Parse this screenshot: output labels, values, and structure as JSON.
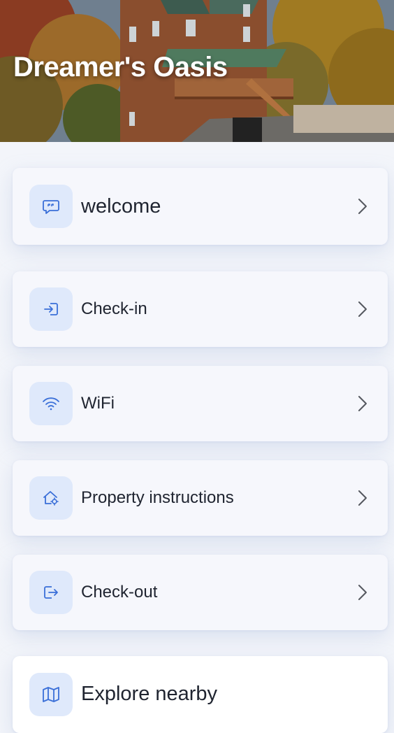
{
  "header": {
    "title": "Dreamer's Oasis"
  },
  "menu": {
    "items": [
      {
        "label": "welcome",
        "icon": "quote-message-icon"
      },
      {
        "label": "Check-in",
        "icon": "sign-in-icon"
      },
      {
        "label": "WiFi",
        "icon": "wifi-icon"
      },
      {
        "label": "Property instructions",
        "icon": "house-gear-icon"
      },
      {
        "label": "Check-out",
        "icon": "sign-out-icon"
      },
      {
        "label": "Explore nearby",
        "icon": "map-icon"
      }
    ]
  },
  "colors": {
    "accent": "#3a6fd8",
    "icon_bg": "#dfe9fb",
    "card_bg": "#f6f7fc",
    "page_bg": "#f3f5fa"
  }
}
